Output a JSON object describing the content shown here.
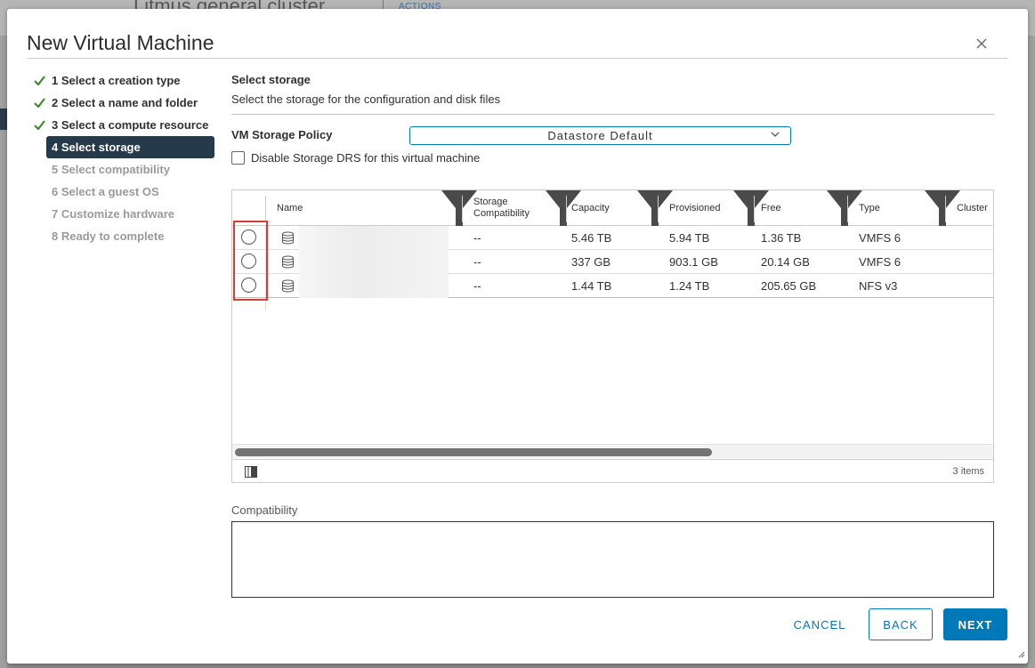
{
  "background": {
    "title": "Litmus general cluster",
    "actions_label": "ACTIONS"
  },
  "dialog": {
    "title": "New Virtual Machine"
  },
  "steps": [
    {
      "label": "1 Select a creation type",
      "state": "done"
    },
    {
      "label": "2 Select a name and folder",
      "state": "done"
    },
    {
      "label": "3 Select a compute resource",
      "state": "done"
    },
    {
      "label": "4 Select storage",
      "state": "active"
    },
    {
      "label": "5 Select compatibility",
      "state": "pending"
    },
    {
      "label": "6 Select a guest OS",
      "state": "pending"
    },
    {
      "label": "7 Customize hardware",
      "state": "pending"
    },
    {
      "label": "8 Ready to complete",
      "state": "pending"
    }
  ],
  "storage": {
    "title": "Select storage",
    "description": "Select the storage for the configuration and disk files",
    "policy_label": "VM Storage Policy",
    "policy_value": "Datastore Default",
    "drs_checkbox_label": "Disable Storage DRS for this virtual machine",
    "drs_checked": false
  },
  "grid": {
    "columns": {
      "name": "Name",
      "compat_line1": "Storage",
      "compat_line2": "Compatibility",
      "capacity": "Capacity",
      "provisioned": "Provisioned",
      "free": "Free",
      "type": "Type",
      "cluster": "Cluster"
    },
    "rows": [
      {
        "compat": "--",
        "capacity": "5.46 TB",
        "provisioned": "5.94 TB",
        "free": "1.36 TB",
        "type": "VMFS 6"
      },
      {
        "compat": "--",
        "capacity": "337 GB",
        "provisioned": "903.1 GB",
        "free": "20.14 GB",
        "type": "VMFS 6"
      },
      {
        "compat": "--",
        "capacity": "1.44 TB",
        "provisioned": "1.24 TB",
        "free": "205.65 GB",
        "type": "NFS v3"
      }
    ],
    "item_count": "3 items"
  },
  "compatibility": {
    "label": "Compatibility"
  },
  "buttons": {
    "cancel": "CANCEL",
    "back": "BACK",
    "next": "NEXT"
  },
  "colors": {
    "accent": "#0079b8",
    "active_step": "#253a4a",
    "check": "#3c8b2c",
    "highlight": "#d93a3a"
  }
}
